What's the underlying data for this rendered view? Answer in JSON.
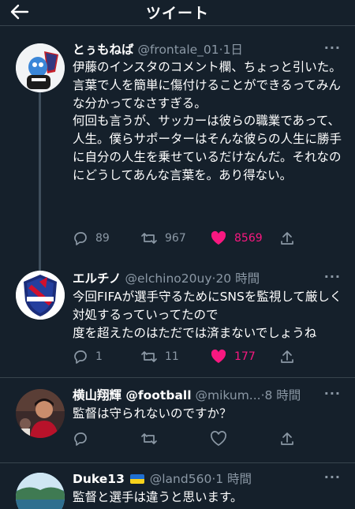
{
  "header": {
    "title": "ツイート",
    "back_icon": "arrow-left-icon"
  },
  "colors": {
    "background": "#15202b",
    "like": "#f91880",
    "muted": "#8b98a5"
  },
  "tweets": [
    {
      "name": "とぅもねば",
      "handle": "@frontale_01",
      "time": "·1日",
      "lines": [
        "伊藤のインスタのコメント欄、ちょっと引いた。",
        "言葉で人を簡単に傷付けることができるってみんな分かってなさすぎる。",
        "何回も言うが、サッカーは彼らの職業であって、人生。僕らサポーターはそんな彼らの人生に勝手に自分の人生を乗せているだけなんだ。それなのにどうしてあんな言葉を。あり得ない。"
      ],
      "replies": "89",
      "retweets": "967",
      "likes": "8569"
    },
    {
      "name": "エルチノ",
      "handle": "@elchino20uy",
      "time": "·20 時間",
      "lines": [
        "今回FIFAが選手守るためにSNSを監視して厳しく対処するっていってたので",
        "度を超えたのはただでは済まないでしょうね"
      ],
      "replies": "1",
      "retweets": "11",
      "likes": "177"
    },
    {
      "name": "横山翔輝 @football",
      "handle": "@mikum...",
      "time": "·8 時間",
      "lines": [
        "監督は守られないのですか？"
      ],
      "replies": "",
      "retweets": "",
      "likes": ""
    },
    {
      "name": "Duke13",
      "handle": "@land560",
      "time": "·1 時間",
      "lines": [
        "監督と選手は違うと思います。"
      ]
    }
  ]
}
